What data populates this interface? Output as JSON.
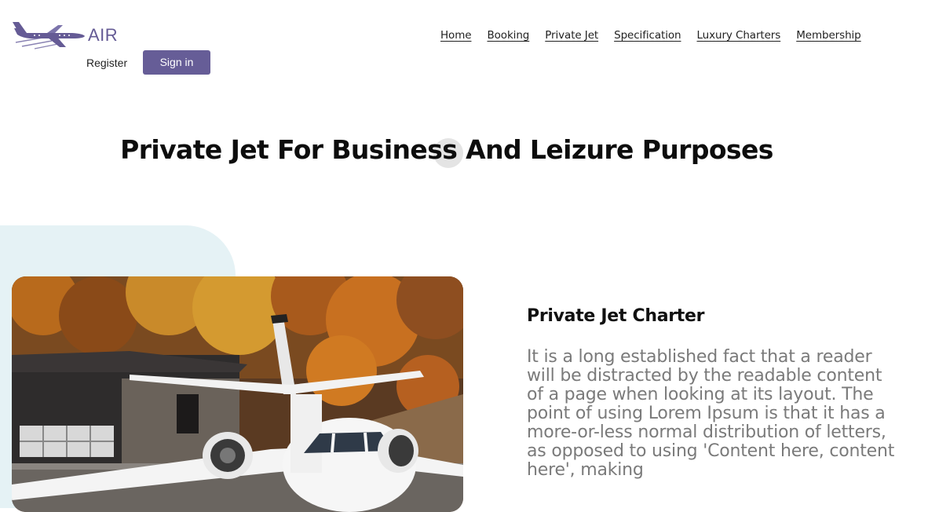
{
  "header": {
    "logo_text": "AIR",
    "register_label": "Register",
    "signin_label": "Sign in",
    "nav": [
      {
        "label": "Home"
      },
      {
        "label": "Booking"
      },
      {
        "label": "Private Jet"
      },
      {
        "label": "Specification"
      },
      {
        "label": "Luxury Charters"
      },
      {
        "label": "Membership"
      }
    ]
  },
  "hero": {
    "title": "Private Jet For Business And Leizure Purposes"
  },
  "content": {
    "title": "Private Jet Charter",
    "body": "It is a long established fact that a reader will be distracted by the readable content of a page when looking at its layout. The point of using Lorem Ipsum is that it has a more-or-less normal distribution of letters, as opposed to using 'Content here, content here', making"
  },
  "colors": {
    "accent": "#665d97",
    "section_background": "#e5f2f5",
    "body_text": "#7a7a7a"
  },
  "icons": {
    "logo": "airplane-icon"
  }
}
